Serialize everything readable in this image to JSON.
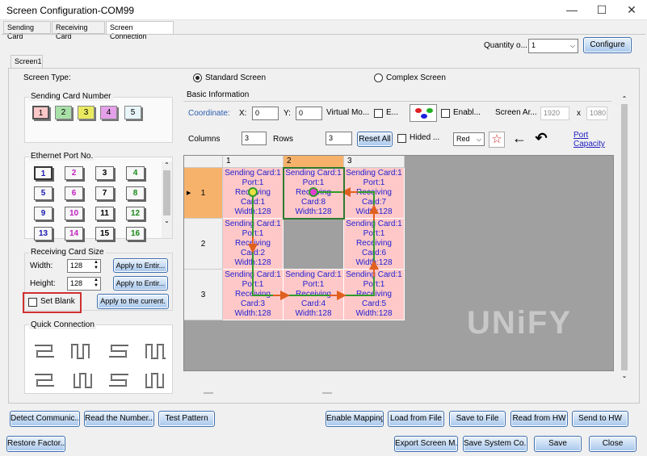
{
  "window": {
    "title": "Screen Configuration-COM99",
    "minimize": "—",
    "maximize": "☐",
    "close": "✕"
  },
  "tabs": [
    "Sending Card",
    "Receiving Card",
    "Screen Connection"
  ],
  "top": {
    "quantity_label": "Quantity o...",
    "quantity_value": "1",
    "configure": "Configure"
  },
  "screen_tab": "Screen1",
  "screen_type": {
    "label": "Screen Type:",
    "standard": "Standard Screen",
    "complex": "Complex Screen"
  },
  "sending_card_number": {
    "title": "Sending Card Number",
    "cards": [
      "1",
      "2",
      "3",
      "4",
      "5"
    ]
  },
  "ethernet_port": {
    "title": "Ethernet Port No.",
    "ports": [
      "1",
      "2",
      "3",
      "4",
      "5",
      "6",
      "7",
      "8",
      "9",
      "10",
      "11",
      "12",
      "13",
      "14",
      "15",
      "16"
    ]
  },
  "receiving_size": {
    "title": "Receiving Card Size",
    "width_label": "Width:",
    "width_value": "128",
    "height_label": "Height:",
    "height_value": "128",
    "apply_width": "Apply to Entir...",
    "apply_height": "Apply to Entir...",
    "set_blank": "Set Blank",
    "apply_current": "Apply to the current."
  },
  "quick_connection": {
    "title": "Quick Connection"
  },
  "basic_info": {
    "title": "Basic Information",
    "coordinate": "Coordinate:",
    "x_label": "X:",
    "x_value": "0",
    "y_label": "Y:",
    "y_value": "0",
    "virtual": "Virtual Mo...",
    "e_label": "E...",
    "enable": "Enabl...",
    "screen_area": "Screen Ar...",
    "area_w": "1920",
    "x_sep": "x",
    "area_h": "1080",
    "columns_label": "Columns",
    "columns_value": "3",
    "rows_label": "Rows",
    "rows_value": "3",
    "reset_all": "Reset All",
    "hided": "Hided ...",
    "color": "Red",
    "port_capacity_1": "Port",
    "port_capacity_2": "Capacity"
  },
  "grid": {
    "col_headers": [
      "1",
      "2",
      "3"
    ],
    "row_headers": [
      "1",
      "2",
      "3"
    ],
    "cells": [
      [
        [
          "Sending Card:1",
          "Port:1",
          "Receiving",
          "Card:1",
          "Width:128"
        ],
        [
          "Sending Card:1",
          "Port:1",
          "Receiving",
          "Card:8",
          "Width:128"
        ],
        [
          "Sending Card:1",
          "Port:1",
          "Receiving",
          "Card:7",
          "Width:128"
        ]
      ],
      [
        [
          "Sending Card:1",
          "Port:1",
          "Receiving",
          "Card:2",
          "Width:128"
        ],
        [],
        [
          "Sending Card:1",
          "Port:1",
          "Receiving",
          "Card:6",
          "Width:128"
        ]
      ],
      [
        [
          "Sending Card:1",
          "Port:1",
          "Receiving",
          "Card:3",
          "Width:128"
        ],
        [
          "Sending Card:1",
          "Port:1",
          "Receiving",
          "Card:4",
          "Width:128"
        ],
        [
          "Sending Card:1",
          "Port:1",
          "Receiving",
          "Card:5",
          "Width:128"
        ]
      ]
    ],
    "watermark": "UNiFY"
  },
  "bottom": {
    "detect": "Detect Communic...",
    "read_number": "Read the Number...",
    "test_pattern": "Test Pattern",
    "enable_mapping": "Enable Mapping",
    "load_file": "Load from File",
    "save_file": "Save to File",
    "read_hw": "Read from HW",
    "send_hw": "Send to HW",
    "restore": "Restore Factor...",
    "export": "Export Screen M...",
    "save_system": "Save System Co...",
    "save": "Save",
    "close": "Close"
  },
  "colors": {
    "accent": "#3c6fb0",
    "cell": "#ffc8c8",
    "cell_text": "#2020d0",
    "selected": "#f6b26b",
    "wire": "#2e9a2e",
    "arrow": "#e06020",
    "blank_highlight": "#d03030"
  }
}
